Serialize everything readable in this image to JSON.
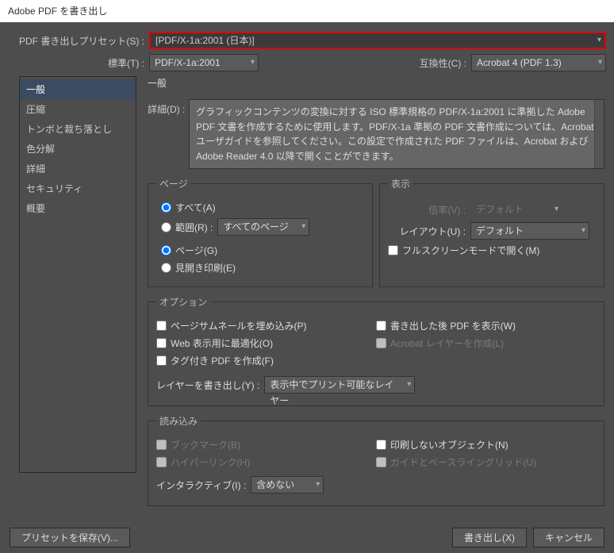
{
  "title": "Adobe PDF を書き出し",
  "preset": {
    "label": "PDF 書き出しプリセット(S) :",
    "value": "[PDF/X-1a:2001 (日本)]"
  },
  "standard": {
    "label": "標準(T) :",
    "value": "PDF/X-1a:2001"
  },
  "compat": {
    "label": "互換性(C) :",
    "value": "Acrobat 4 (PDF 1.3)"
  },
  "sidebar": {
    "items": [
      {
        "label": "一般"
      },
      {
        "label": "圧縮"
      },
      {
        "label": "トンボと裁ち落とし"
      },
      {
        "label": "色分解"
      },
      {
        "label": "詳細"
      },
      {
        "label": "セキュリティ"
      },
      {
        "label": "概要"
      }
    ]
  },
  "main_title": "一般",
  "detail": {
    "label": "詳細(D) :",
    "text": "グラフィックコンテンツの変換に対する ISO 標準規格の PDF/X-1a:2001 に準拠した Adobe PDF 文書を作成するために使用します。PDF/X-1a 準拠の PDF 文書作成については、Acrobat ユーザガイドを参照してください。この設定で作成された PDF ファイルは、Acrobat および Adobe Reader 4.0 以降で開くことができます。"
  },
  "pages": {
    "legend": "ページ",
    "all": "すべて(A)",
    "range": "範囲(R) :",
    "range_value": "すべてのページ",
    "page": "ページ(G)",
    "spread": "見開き印刷(E)"
  },
  "view": {
    "legend": "表示",
    "zoom_label": "倍率(V) :",
    "zoom_value": "デフォルト",
    "layout_label": "レイアウト(U) :",
    "layout_value": "デフォルト",
    "fullscreen": "フルスクリーンモードで開く(M)"
  },
  "options": {
    "legend": "オプション",
    "thumb": "ページサムネールを埋め込み(P)",
    "show_after": "書き出した後 PDF を表示(W)",
    "web": "Web 表示用に最適化(O)",
    "acro_layer": "Acrobat レイヤーを作成(L)",
    "tagged": "タグ付き PDF を作成(F)",
    "layers_label": "レイヤーを書き出し(Y) :",
    "layers_value": "表示中でプリント可能なレイヤー"
  },
  "include": {
    "legend": "読み込み",
    "bookmark": "ブックマーク(B)",
    "nonprint": "印刷しないオブジェクト(N)",
    "hyper": "ハイパーリンク(H)",
    "guides": "ガイドとベースライングリッド(U)",
    "inter_label": "インタラクティブ(I) :",
    "inter_value": "含めない"
  },
  "footer": {
    "save_preset": "プリセットを保存(V)...",
    "export": "書き出し(X)",
    "cancel": "キャンセル"
  }
}
